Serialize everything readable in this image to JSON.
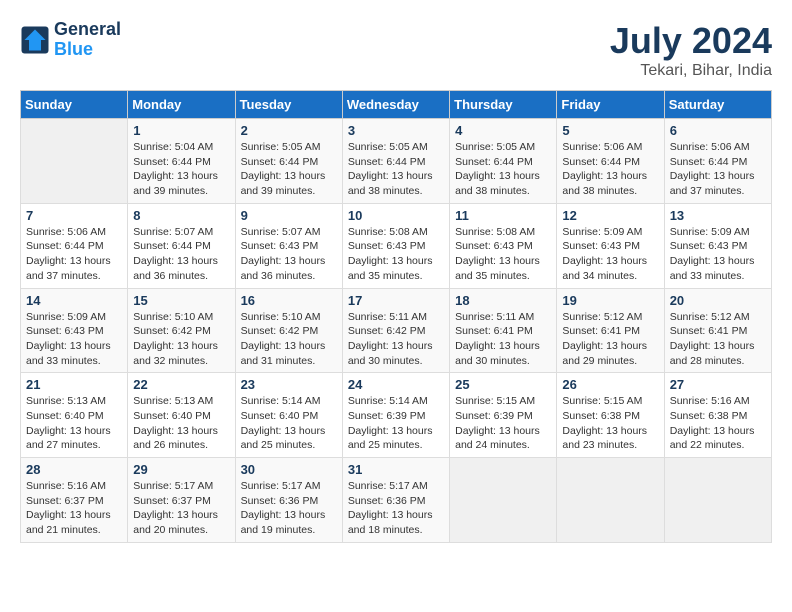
{
  "header": {
    "logo_general": "General",
    "logo_blue": "Blue",
    "month_year": "July 2024",
    "location": "Tekari, Bihar, India"
  },
  "weekdays": [
    "Sunday",
    "Monday",
    "Tuesday",
    "Wednesday",
    "Thursday",
    "Friday",
    "Saturday"
  ],
  "weeks": [
    [
      {
        "day": "",
        "info": ""
      },
      {
        "day": "1",
        "info": "Sunrise: 5:04 AM\nSunset: 6:44 PM\nDaylight: 13 hours\nand 39 minutes."
      },
      {
        "day": "2",
        "info": "Sunrise: 5:05 AM\nSunset: 6:44 PM\nDaylight: 13 hours\nand 39 minutes."
      },
      {
        "day": "3",
        "info": "Sunrise: 5:05 AM\nSunset: 6:44 PM\nDaylight: 13 hours\nand 38 minutes."
      },
      {
        "day": "4",
        "info": "Sunrise: 5:05 AM\nSunset: 6:44 PM\nDaylight: 13 hours\nand 38 minutes."
      },
      {
        "day": "5",
        "info": "Sunrise: 5:06 AM\nSunset: 6:44 PM\nDaylight: 13 hours\nand 38 minutes."
      },
      {
        "day": "6",
        "info": "Sunrise: 5:06 AM\nSunset: 6:44 PM\nDaylight: 13 hours\nand 37 minutes."
      }
    ],
    [
      {
        "day": "7",
        "info": "Sunrise: 5:06 AM\nSunset: 6:44 PM\nDaylight: 13 hours\nand 37 minutes."
      },
      {
        "day": "8",
        "info": "Sunrise: 5:07 AM\nSunset: 6:44 PM\nDaylight: 13 hours\nand 36 minutes."
      },
      {
        "day": "9",
        "info": "Sunrise: 5:07 AM\nSunset: 6:43 PM\nDaylight: 13 hours\nand 36 minutes."
      },
      {
        "day": "10",
        "info": "Sunrise: 5:08 AM\nSunset: 6:43 PM\nDaylight: 13 hours\nand 35 minutes."
      },
      {
        "day": "11",
        "info": "Sunrise: 5:08 AM\nSunset: 6:43 PM\nDaylight: 13 hours\nand 35 minutes."
      },
      {
        "day": "12",
        "info": "Sunrise: 5:09 AM\nSunset: 6:43 PM\nDaylight: 13 hours\nand 34 minutes."
      },
      {
        "day": "13",
        "info": "Sunrise: 5:09 AM\nSunset: 6:43 PM\nDaylight: 13 hours\nand 33 minutes."
      }
    ],
    [
      {
        "day": "14",
        "info": "Sunrise: 5:09 AM\nSunset: 6:43 PM\nDaylight: 13 hours\nand 33 minutes."
      },
      {
        "day": "15",
        "info": "Sunrise: 5:10 AM\nSunset: 6:42 PM\nDaylight: 13 hours\nand 32 minutes."
      },
      {
        "day": "16",
        "info": "Sunrise: 5:10 AM\nSunset: 6:42 PM\nDaylight: 13 hours\nand 31 minutes."
      },
      {
        "day": "17",
        "info": "Sunrise: 5:11 AM\nSunset: 6:42 PM\nDaylight: 13 hours\nand 30 minutes."
      },
      {
        "day": "18",
        "info": "Sunrise: 5:11 AM\nSunset: 6:41 PM\nDaylight: 13 hours\nand 30 minutes."
      },
      {
        "day": "19",
        "info": "Sunrise: 5:12 AM\nSunset: 6:41 PM\nDaylight: 13 hours\nand 29 minutes."
      },
      {
        "day": "20",
        "info": "Sunrise: 5:12 AM\nSunset: 6:41 PM\nDaylight: 13 hours\nand 28 minutes."
      }
    ],
    [
      {
        "day": "21",
        "info": "Sunrise: 5:13 AM\nSunset: 6:40 PM\nDaylight: 13 hours\nand 27 minutes."
      },
      {
        "day": "22",
        "info": "Sunrise: 5:13 AM\nSunset: 6:40 PM\nDaylight: 13 hours\nand 26 minutes."
      },
      {
        "day": "23",
        "info": "Sunrise: 5:14 AM\nSunset: 6:40 PM\nDaylight: 13 hours\nand 25 minutes."
      },
      {
        "day": "24",
        "info": "Sunrise: 5:14 AM\nSunset: 6:39 PM\nDaylight: 13 hours\nand 25 minutes."
      },
      {
        "day": "25",
        "info": "Sunrise: 5:15 AM\nSunset: 6:39 PM\nDaylight: 13 hours\nand 24 minutes."
      },
      {
        "day": "26",
        "info": "Sunrise: 5:15 AM\nSunset: 6:38 PM\nDaylight: 13 hours\nand 23 minutes."
      },
      {
        "day": "27",
        "info": "Sunrise: 5:16 AM\nSunset: 6:38 PM\nDaylight: 13 hours\nand 22 minutes."
      }
    ],
    [
      {
        "day": "28",
        "info": "Sunrise: 5:16 AM\nSunset: 6:37 PM\nDaylight: 13 hours\nand 21 minutes."
      },
      {
        "day": "29",
        "info": "Sunrise: 5:17 AM\nSunset: 6:37 PM\nDaylight: 13 hours\nand 20 minutes."
      },
      {
        "day": "30",
        "info": "Sunrise: 5:17 AM\nSunset: 6:36 PM\nDaylight: 13 hours\nand 19 minutes."
      },
      {
        "day": "31",
        "info": "Sunrise: 5:17 AM\nSunset: 6:36 PM\nDaylight: 13 hours\nand 18 minutes."
      },
      {
        "day": "",
        "info": ""
      },
      {
        "day": "",
        "info": ""
      },
      {
        "day": "",
        "info": ""
      }
    ]
  ]
}
